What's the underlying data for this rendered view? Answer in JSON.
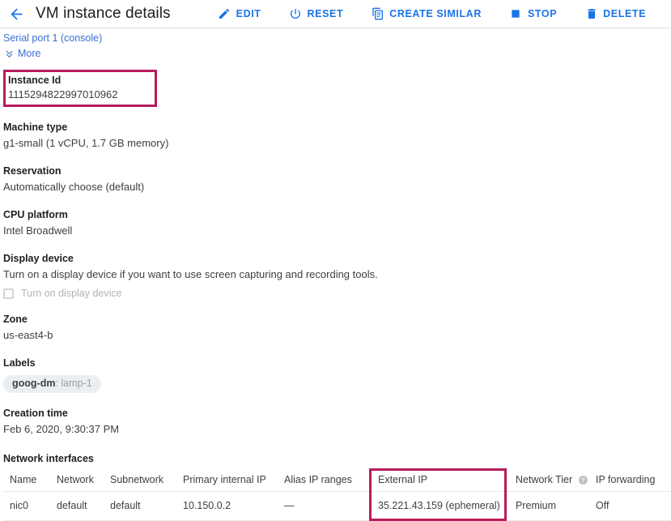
{
  "header": {
    "back_icon": "arrow-back-icon",
    "title": "VM instance details",
    "actions": [
      {
        "label": "EDIT",
        "icon": "pencil-icon"
      },
      {
        "label": "RESET",
        "icon": "power-reset-icon"
      },
      {
        "label": "CREATE SIMILAR",
        "icon": "duplicate-icon"
      },
      {
        "label": "STOP",
        "icon": "stop-square-icon"
      },
      {
        "label": "DELETE",
        "icon": "trash-icon"
      }
    ]
  },
  "links": {
    "serial_port": "Serial port 1 (console)",
    "more": "More",
    "more_icon": "double-chevron-down-icon"
  },
  "fields": {
    "instance_id": {
      "label": "Instance Id",
      "value": "1115294822997010962",
      "highlighted": true
    },
    "machine_type": {
      "label": "Machine type",
      "value": "g1-small (1 vCPU, 1.7 GB memory)"
    },
    "reservation": {
      "label": "Reservation",
      "value": "Automatically choose (default)"
    },
    "cpu_platform": {
      "label": "CPU platform",
      "value": "Intel Broadwell"
    },
    "display_device": {
      "label": "Display device",
      "value": "Turn on a display device if you want to use screen capturing and recording tools.",
      "checkbox_label": "Turn on display device",
      "checkbox_checked": false,
      "checkbox_disabled": true
    },
    "zone": {
      "label": "Zone",
      "value": "us-east4-b"
    },
    "labels": {
      "label": "Labels",
      "chips": [
        {
          "key": "goog-dm",
          "separator": ":",
          "value": "lamp-1"
        }
      ]
    },
    "creation_time": {
      "label": "Creation time",
      "value": "Feb 6, 2020, 9:30:37 PM"
    }
  },
  "network_interfaces": {
    "title": "Network interfaces",
    "columns": [
      {
        "label": "Name"
      },
      {
        "label": "Network"
      },
      {
        "label": "Subnetwork"
      },
      {
        "label": "Primary internal IP"
      },
      {
        "label": "Alias IP ranges"
      },
      {
        "label": "External IP",
        "highlighted": true
      },
      {
        "label": "Network Tier",
        "help_icon": "help-circle-icon"
      },
      {
        "label": "IP forwarding"
      }
    ],
    "rows": [
      {
        "name": "nic0",
        "network": "default",
        "subnetwork": "default",
        "primary_internal_ip": "10.150.0.2",
        "alias_ip_ranges": "—",
        "external_ip": "35.221.43.159 (ephemeral)",
        "network_tier": "Premium",
        "ip_forwarding": "Off"
      }
    ]
  },
  "colors": {
    "accent_blue": "#1a73e8",
    "link_blue": "#3b6fd4",
    "highlight_crimson": "#b81c5b",
    "text_primary": "#202124",
    "text_secondary": "#3c4043",
    "chip_bg": "#eceff1",
    "divider": "#dadce0"
  }
}
